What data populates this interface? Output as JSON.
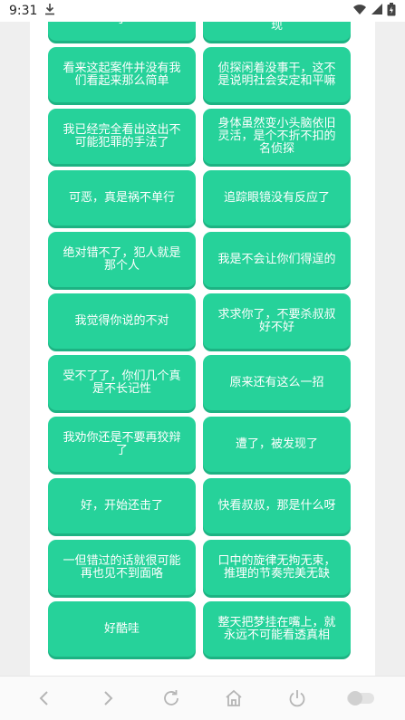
{
  "status_bar": {
    "time": "9:31",
    "icons": [
      "download-icon",
      "wifi-icon",
      "signal-icon",
      "battery-icon"
    ]
  },
  "buttons": [
    [
      "么可能每次碰巧遇上案子",
      "的事物，只要用心观察，就一定会有新的发现"
    ],
    [
      "看来这起案件并没有我们看起来那么简单",
      "侦探闲着没事干，这不是说明社会安定和平嘛"
    ],
    [
      "我已经完全看出这出不可能犯罪的手法了",
      "身体虽然变小头脑依旧灵活，是个不折不扣的名侦探"
    ],
    [
      "可恶，真是祸不单行",
      "追踪眼镜没有反应了"
    ],
    [
      "绝对错不了，犯人就是那个人",
      "我是不会让你们得逞的"
    ],
    [
      "我觉得你说的不对",
      "求求你了，不要杀叔叔好不好"
    ],
    [
      "受不了了，你们几个真是不长记性",
      "原来还有这么一招"
    ],
    [
      "我劝你还是不要再狡辩了",
      "遭了，被发现了"
    ],
    [
      "好，开始还击了",
      "快看叔叔，那是什么呀"
    ],
    [
      "一但错过的话就很可能再也见不到面咯",
      "口中的旋律无拘无束，推理的节奏完美无缺"
    ],
    [
      "好酷哇",
      "整天把梦挂在嘴上，就永远不可能看透真相"
    ]
  ],
  "colors": {
    "tile": "#26d29a",
    "tile_shadow": "#1db383",
    "tile_text": "#ffffff",
    "page_bg": "#efefef",
    "panel_bg": "#ffffff"
  },
  "nav_bar": {
    "items": [
      "back-icon",
      "forward-icon",
      "refresh-icon",
      "home-icon",
      "power-icon",
      "toggle-icon"
    ]
  }
}
